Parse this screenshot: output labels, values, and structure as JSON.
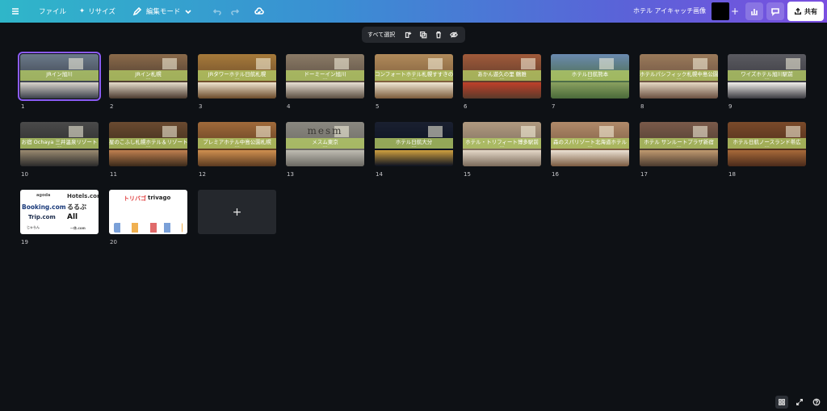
{
  "topbar": {
    "menu_label": "ファイル",
    "resize_label": "リサイズ",
    "edit_mode_label": "編集モード",
    "document_title": "ホテル アイキャッチ画像",
    "share_label": "共有"
  },
  "selection_toolbar": {
    "select_all_label": "すべて選択"
  },
  "pages": [
    {
      "num": "1",
      "caption": "JRイン旭川",
      "sub": "ーー"
    },
    {
      "num": "2",
      "caption": "JRイン札幌",
      "sub": "ーー"
    },
    {
      "num": "3",
      "caption": "JRタワーホテル日航札幌",
      "sub": "ーー"
    },
    {
      "num": "4",
      "caption": "ドーミーイン旭川",
      "sub": "ーー"
    },
    {
      "num": "5",
      "caption": "コンフォートホテル札幌すすきの",
      "sub": "ーー"
    },
    {
      "num": "6",
      "caption": "あかん遊久の里 鶴雅",
      "sub": "ーー"
    },
    {
      "num": "7",
      "caption": "ホテル日航熊本",
      "sub": "ーー"
    },
    {
      "num": "8",
      "caption": "ホテルパシフィック札幌中島公園",
      "sub": "ーー"
    },
    {
      "num": "9",
      "caption": "ワイズホテル旭川駅前",
      "sub": "ーー"
    },
    {
      "num": "10",
      "caption": "お宿 Ochaya 三井温泉リゾート",
      "sub": "ーー"
    },
    {
      "num": "11",
      "caption": "星のこふし札幌ホテル＆リゾート",
      "sub": "ーー"
    },
    {
      "num": "12",
      "caption": "プレミアホテル中島公園札幌",
      "sub": "ーー"
    },
    {
      "num": "13",
      "caption": "メスム東京",
      "sub": "ーー"
    },
    {
      "num": "14",
      "caption": "ホテル日航大分",
      "sub": "ーー"
    },
    {
      "num": "15",
      "caption": "ホテル・トリフィート博多駅前",
      "sub": "ーー"
    },
    {
      "num": "16",
      "caption": "森のスパリゾート北海道ホテル",
      "sub": "ーー"
    },
    {
      "num": "17",
      "caption": "ホテル サンルートプラザ新宿",
      "sub": "ーー"
    },
    {
      "num": "18",
      "caption": "ホテル日航ノースランド帯広",
      "sub": "ーー"
    },
    {
      "num": "19",
      "caption": "",
      "sub": ""
    },
    {
      "num": "20",
      "caption": "",
      "sub": ""
    }
  ],
  "thumb13_logo": "mesm",
  "logos19": {
    "agoda": "agoda",
    "hotels": "Hotels.com",
    "booking": "Booking.com",
    "rurubu": "るるぶ",
    "trip": "Trip.com",
    "all": "All",
    "jalan": "じゃらん",
    "ikyu": "一休.com"
  },
  "logos20": {
    "tripadvisor": "トリバゴ",
    "trivago": "trivago"
  },
  "add_page_label": "+",
  "colors": {
    "accent": "#8b5cf6",
    "band": "#b2c864",
    "background": "#0e1115"
  }
}
